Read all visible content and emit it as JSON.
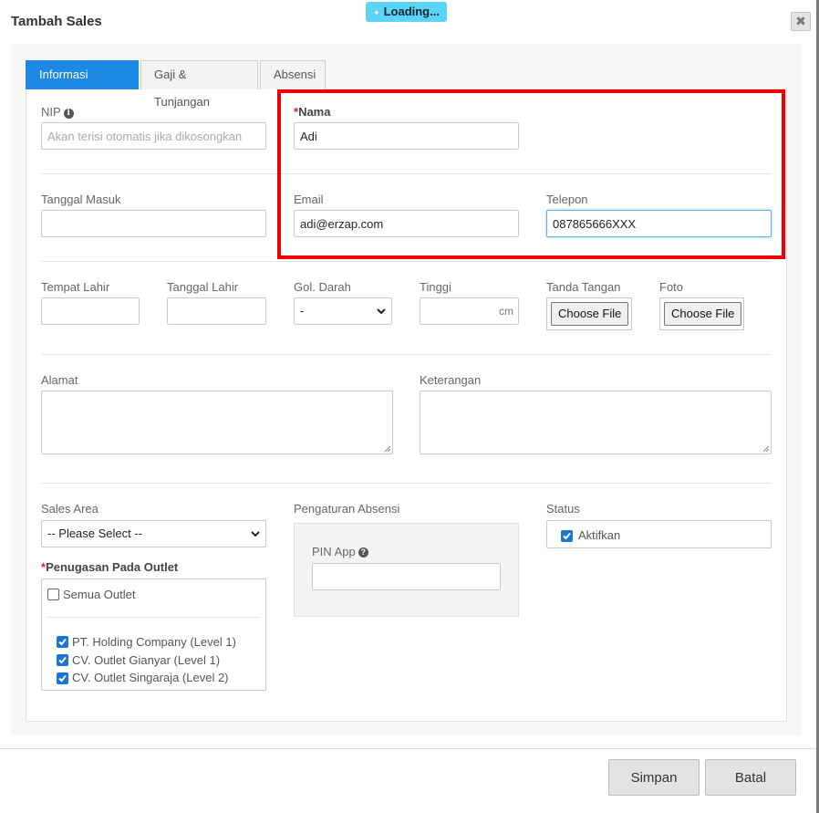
{
  "dialog": {
    "title": "Tambah Sales",
    "close_symbol": "✖",
    "loading_text": "Loading..."
  },
  "tabs": [
    {
      "label": "Informasi Umum",
      "active": true
    },
    {
      "label": "Gaji & Tunjangan",
      "active": false
    },
    {
      "label": "Absensi",
      "active": false
    }
  ],
  "form": {
    "nip": {
      "label": "NIP",
      "placeholder": "Akan terisi otomatis jika dikosongkan",
      "value": ""
    },
    "nama": {
      "required_mark": "*",
      "label": "Nama",
      "value": "Adi"
    },
    "tanggal_masuk": {
      "label": "Tanggal Masuk",
      "value": ""
    },
    "email": {
      "label": "Email",
      "value": "adi@erzap.com"
    },
    "telepon": {
      "label": "Telepon",
      "value": "087865666XXX"
    },
    "tempat_lahir": {
      "label": "Tempat Lahir",
      "value": ""
    },
    "tanggal_lahir": {
      "label": "Tanggal Lahir",
      "value": ""
    },
    "gol_darah": {
      "label": "Gol. Darah",
      "value": "-"
    },
    "tinggi": {
      "label": "Tinggi",
      "unit": "cm",
      "value": ""
    },
    "tanda_tangan": {
      "label": "Tanda Tangan",
      "button": "Choose File"
    },
    "foto": {
      "label": "Foto",
      "button": "Choose File"
    },
    "alamat": {
      "label": "Alamat",
      "value": ""
    },
    "keterangan": {
      "label": "Keterangan",
      "value": ""
    },
    "sales_area": {
      "label": "Sales Area",
      "value": "-- Please Select --"
    },
    "penugasan": {
      "required_mark": "*",
      "label": "Penugasan Pada Outlet",
      "all_label": "Semua Outlet",
      "all_checked": false,
      "outlets": [
        {
          "label": "PT. Holding Company (Level 1)",
          "checked": true
        },
        {
          "label": "CV. Outlet Gianyar (Level 1)",
          "checked": true
        },
        {
          "label": "CV. Outlet Singaraja (Level 2)",
          "checked": true
        }
      ]
    },
    "pengaturan_absensi": {
      "label": "Pengaturan Absensi",
      "pin_label": "PIN App",
      "pin_value": ""
    },
    "status": {
      "label": "Status",
      "checkbox_label": "Aktifkan",
      "checked": true
    }
  },
  "footer": {
    "save_label": "Simpan",
    "cancel_label": "Batal"
  },
  "colors": {
    "tab_active": "#1e88e5",
    "checkbox": "#1976d2",
    "highlight": "#ee0000",
    "loading": "#5bd4f5"
  },
  "icons": {
    "nip_info": "info-icon",
    "pin_help": "question-icon",
    "close": "close-icon"
  }
}
